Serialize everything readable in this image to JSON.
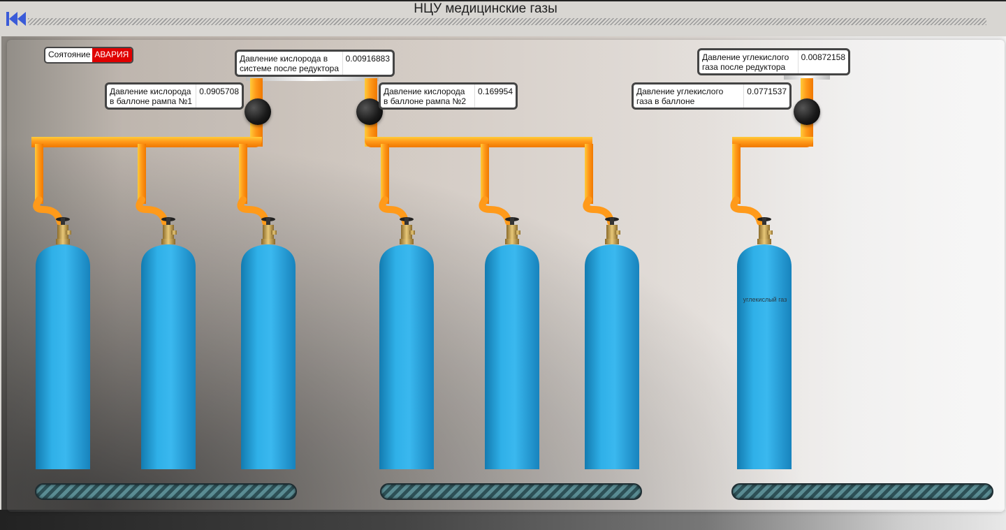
{
  "header": {
    "title": "НЦУ медицинские газы"
  },
  "status": {
    "label": "Соятояние",
    "value": "АВАРИЯ",
    "value_color": "#e00000"
  },
  "readouts": {
    "o2_system": {
      "label": "Давление кислорода в системе после редуктора",
      "value": "0.00916883"
    },
    "o2_ramp1": {
      "label": "Давление кислорода в баллоне рампа №1",
      "value": "0.0905708"
    },
    "o2_ramp2": {
      "label": "Давление кислорода в баллоне рампа №2",
      "value": "0.169954"
    },
    "co2_system": {
      "label": "Давление углекислого газа после редуктора",
      "value": "0.00872158"
    },
    "co2_cylinder": {
      "label": "Давление углекислого газа в баллоне",
      "value": "0.0771537"
    }
  },
  "cylinders": {
    "co2_label": "углекислый газ"
  },
  "colors": {
    "pipe": "#ff9a1a",
    "cylinder": "#2aa0d8",
    "alarm": "#e00000"
  },
  "icons": {
    "back": "double-chevron-left-icon"
  }
}
